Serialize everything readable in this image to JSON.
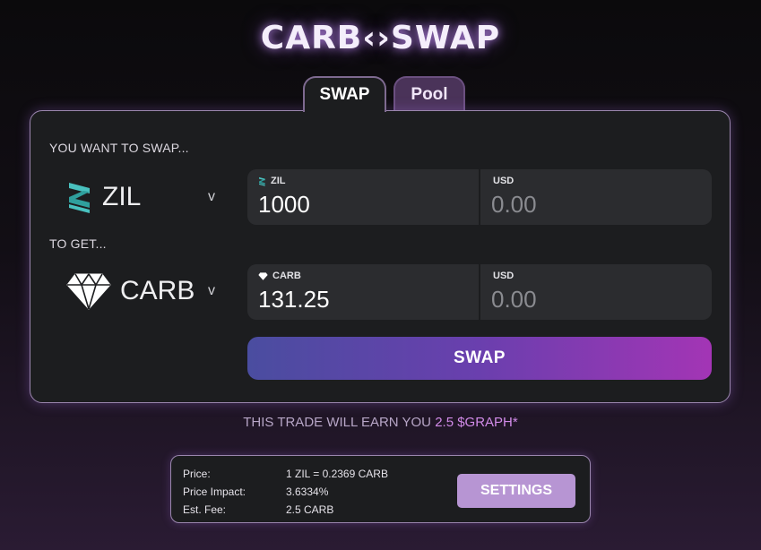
{
  "app": {
    "logo_text": "CARB‹›SWAP"
  },
  "tabs": [
    {
      "label": "SWAP",
      "active": true
    },
    {
      "label": "Pool",
      "active": false
    }
  ],
  "swap": {
    "from_label": "YOU WANT TO SWAP...",
    "to_label": "TO GET...",
    "from_token": {
      "symbol": "ZIL",
      "icon": "zil-icon",
      "amount": "1000",
      "usd_label": "USD",
      "usd_placeholder": "0.00"
    },
    "to_token": {
      "symbol": "CARB",
      "icon": "diamond-icon",
      "amount": "131.25",
      "usd_label": "USD",
      "usd_placeholder": "0.00"
    },
    "dropdown_glyph": "v",
    "button_label": "SWAP"
  },
  "earn": {
    "prefix": "THIS TRADE WILL EARN YOU ",
    "amount": "2.5 $GRAPH*"
  },
  "info": {
    "rows": [
      {
        "label": "Price:",
        "value": "1 ZIL = 0.2369 CARB"
      },
      {
        "label": "Price Impact:",
        "value": "3.6334%"
      },
      {
        "label": "Est. Fee:",
        "value": "2.5 CARB"
      }
    ],
    "settings_label": "SETTINGS"
  },
  "colors": {
    "accent": "#a335b5",
    "zil_teal": "#49c1bf",
    "card_bg": "#1c1d1f",
    "settings_bg": "#b795d3"
  }
}
